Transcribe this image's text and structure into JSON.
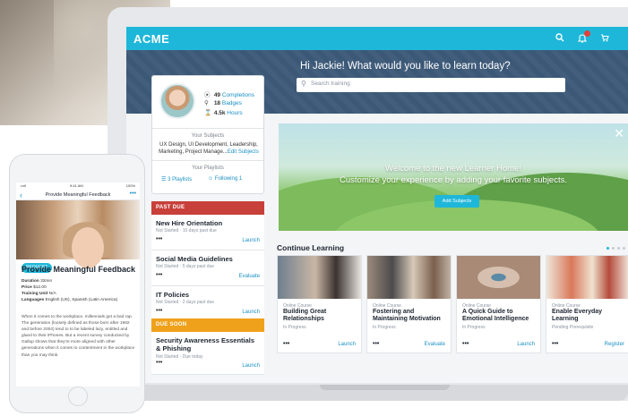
{
  "app": {
    "brand": "ACME"
  },
  "header": {
    "icons": [
      "search-icon",
      "bell-icon",
      "cart-icon"
    ],
    "greeting": "Hi Jackie! What would you like to learn today?",
    "search_placeholder": "Search training"
  },
  "profile": {
    "stats": [
      {
        "number": "49",
        "label": "Completions",
        "icon": "check-circle-icon"
      },
      {
        "number": "18",
        "label": "Badges",
        "icon": "badge-icon"
      },
      {
        "number": "4.5k",
        "label": "Hours",
        "icon": "hourglass-icon"
      }
    ],
    "subjects_title": "Your Subjects",
    "subjects_text": "UX Design, UI Development, Leadership, Marketing, Project Manage...",
    "subjects_edit": "Edit Subjects",
    "playlists_title": "Your Playlists",
    "playlists_count": "3 Playlists",
    "following_count": "Following 1"
  },
  "past_due": {
    "heading": "PAST DUE",
    "color": "#c8403a",
    "tasks": [
      {
        "title": "New Hire Orientation",
        "meta": "Not Started  ·  10 days past due",
        "action": "Launch"
      },
      {
        "title": "Social Media Guidelines",
        "meta": "Not Started  ·  5 days past due",
        "action": "Evaluate"
      },
      {
        "title": "IT Policies",
        "meta": "Not Started  ·  2 days past due",
        "action": "Launch"
      }
    ]
  },
  "due_soon": {
    "heading": "DUE SOON",
    "color": "#f0a11b",
    "tasks": [
      {
        "title": "Security Awareness Essentials & Phishing",
        "meta": "Not Started  ·  Due today",
        "action": "Launch"
      }
    ]
  },
  "banner": {
    "line1": "Welcome to the new Learner Home!",
    "line2": "Customize your experience by adding your favorite subjects.",
    "button": "Add Subjects"
  },
  "continue_learning": {
    "title": "Continue Learning",
    "cards": [
      {
        "type": "Online Course",
        "title": "Building Great Relationships",
        "status": "In Progress",
        "action": "Launch"
      },
      {
        "type": "Online Course",
        "title": "Fostering and Maintaining Motivation",
        "status": "In Progress",
        "action": "Evaluate"
      },
      {
        "type": "Online Course",
        "title": "A Quick Guide to Emotional Intelligence",
        "status": "In Progress",
        "action": "Launch"
      },
      {
        "type": "Online Course",
        "title": "Enable Everyday Learning",
        "status": "Pending Prerequisite",
        "action": "Register"
      }
    ]
  },
  "phone": {
    "status_left": "•••ll",
    "status_time": "9:41 AM",
    "status_right": "100%",
    "nav_title": "Provide Meaningful Feedback",
    "request_button": "REQUEST",
    "heading": "Provide Meaningful Feedback",
    "meta": [
      {
        "label": "Duration",
        "value": "32min"
      },
      {
        "label": "Price",
        "value": "$12.00"
      },
      {
        "label": "Training Unit",
        "value": "N/A"
      },
      {
        "label": "Languages",
        "value": "English (US), Spanish (Latin America)"
      }
    ],
    "body": "When it comes to the workplace, millennials get a bad rap. The generation (loosely defined as those born after 1982 and before 2004) tend to to be labeled lazy, entitled and glued to their iPhones. But a recent survey conducted by Gallup shows that they're more aligned with other generations when it comes to contentment in the workplace than you may think."
  },
  "colors": {
    "accent": "#1fb7d9",
    "hero": "#3b5877",
    "link": "#1a8fc4"
  }
}
